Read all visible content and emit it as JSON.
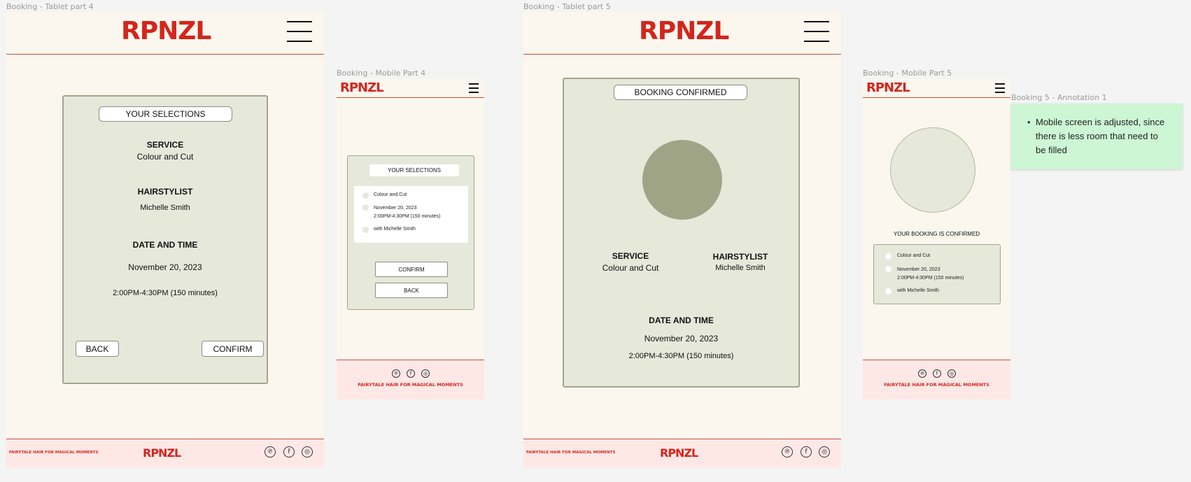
{
  "brand": {
    "logo": "RPNZL",
    "tagline": "FAIRYTALE HAIR FOR MAGICAL MOMENTS",
    "red": "#d3261d",
    "cream": "#fbf7ef",
    "sage": "#e6e8da",
    "sage_dark": "#9fa487",
    "footer_pink": "#fde8e6"
  },
  "social_icons": [
    {
      "icon": "pinterest-icon",
      "glyph": "℗"
    },
    {
      "icon": "facebook-icon",
      "glyph": "f"
    },
    {
      "icon": "instagram-icon",
      "glyph": "◎"
    }
  ],
  "tablet4": {
    "frame_label": "Booking - Tablet part 4",
    "title": "YOUR SELECTIONS",
    "service_heading": "SERVICE",
    "service_value": "Colour and Cut",
    "stylist_heading": "HAIRSTYLIST",
    "stylist_value": "Michelle Smith",
    "datetime_heading": "DATE AND TIME",
    "date": "November 20, 2023",
    "time": "2:00PM-4:30PM (150 minutes)",
    "back_label": "BACK",
    "confirm_label": "CONFIRM"
  },
  "mobile4": {
    "frame_label": "Booking - Mobile Part 4",
    "title": "YOUR SELECTIONS",
    "items": [
      "Colour and Cut",
      "November 20, 2023",
      "2:00PM-4:30PM (150 minutes)",
      "with Michelle Smith"
    ],
    "confirm_label": "CONFIRM",
    "back_label": "BACK"
  },
  "tablet5": {
    "frame_label": "Booking - Tablet part 5",
    "title": "BOOKING CONFIRMED",
    "service_heading": "SERVICE",
    "service_value": "Colour and Cut",
    "stylist_heading": "HAIRSTYLIST",
    "stylist_value": "Michelle Smith",
    "datetime_heading": "DATE AND TIME",
    "date": "November 20, 2023",
    "time": "2:00PM-4:30PM (150 minutes)"
  },
  "mobile5": {
    "frame_label": "Booking - Mobile Part 5",
    "confirmed_text": "YOUR BOOKING IS CONFIRMED",
    "items": [
      "Colour and Cut",
      "November 20, 2023",
      "2:00PM-4:30PM (150 minutes)",
      "with Michelle Smith"
    ]
  },
  "annotation": {
    "label": "Booking 5 - Annotation 1",
    "text": "Mobile screen is adjusted, since there is less room that need to be filled"
  }
}
